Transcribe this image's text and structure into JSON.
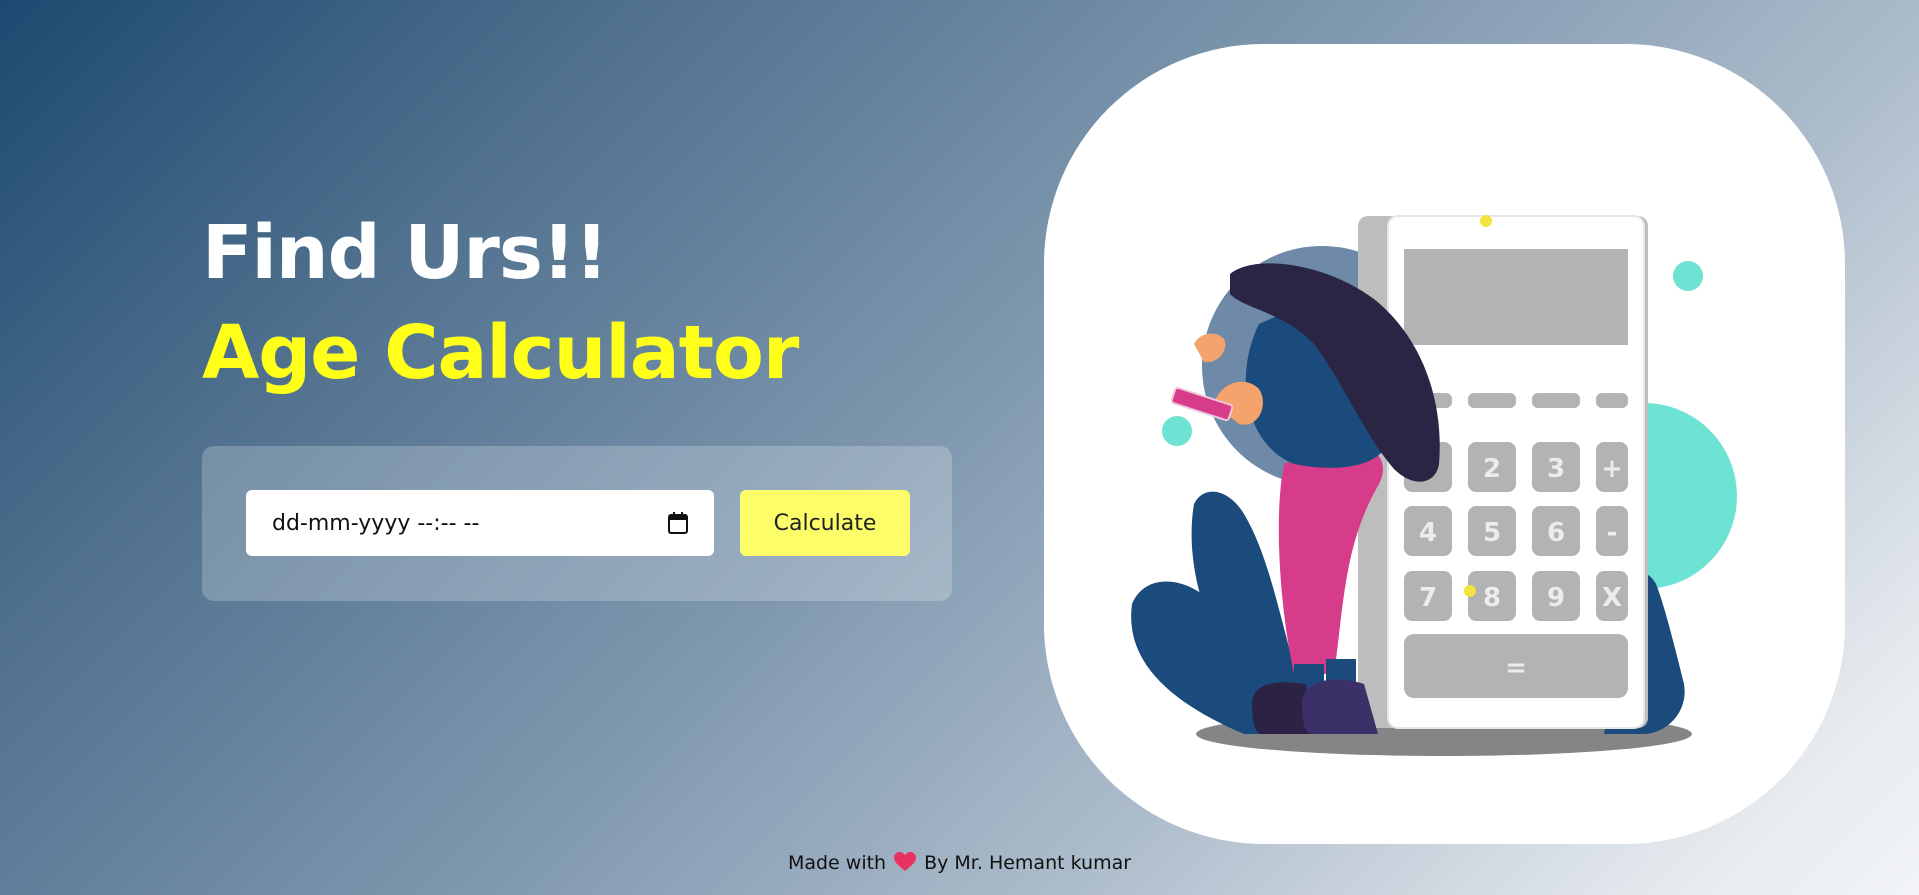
{
  "hero": {
    "title_top": "Find Urs!!",
    "title_main": "Age Calculator"
  },
  "form": {
    "date_placeholder": "dd-mm-yyyy --:-- --",
    "calculate_label": "Calculate"
  },
  "calculator_keys": [
    "2",
    "3",
    "+",
    "4",
    "5",
    "6",
    "-",
    "7",
    "8",
    "9",
    "X",
    "="
  ],
  "footer": {
    "prefix": "Made with",
    "suffix": "By Mr. Hemant kumar"
  },
  "colors": {
    "accent_yellow": "#ffff1a",
    "button_yellow": "#fdfd6a",
    "teal": "#6ee2d3",
    "navy": "#1a4b7c",
    "pink": "#d63c8a"
  },
  "icons": [
    "calendar-icon",
    "heart-icon"
  ]
}
